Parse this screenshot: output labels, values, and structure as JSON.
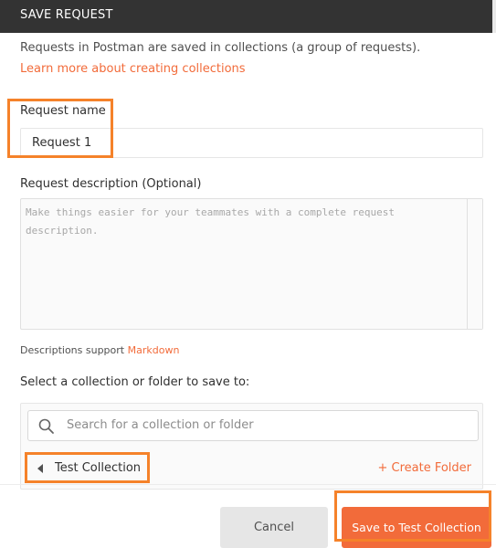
{
  "dialog": {
    "title": "SAVE REQUEST",
    "intro_text": "Requests in Postman are saved in collections (a group of requests).",
    "learn_more_link": "Learn more about creating collections"
  },
  "request_name": {
    "label": "Request name",
    "value": "Request 1"
  },
  "request_description": {
    "label": "Request description (Optional)",
    "placeholder": "Make things easier for your teammates with a complete request description.",
    "markdown_note": "Descriptions support",
    "markdown_link": "Markdown"
  },
  "collection_picker": {
    "label": "Select a collection or folder to save to:",
    "search_placeholder": "Search for a collection or folder",
    "current_collection": "Test Collection",
    "create_folder_label": "+ Create Folder"
  },
  "footer": {
    "cancel_label": "Cancel",
    "save_label": "Save to Test Collection"
  },
  "colors": {
    "accent": "#f26b3a",
    "header_bg": "#333333",
    "annotation": "#f5822a"
  }
}
